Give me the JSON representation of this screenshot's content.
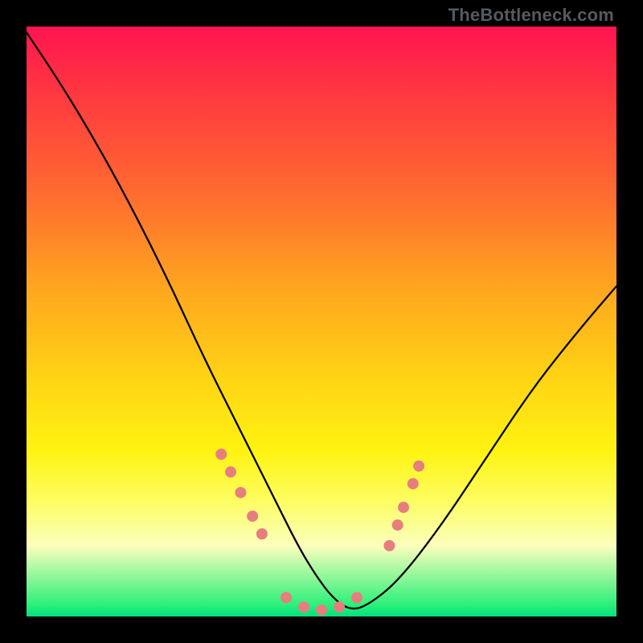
{
  "attribution": "TheBottleneck.com",
  "chart_data": {
    "type": "line",
    "title": "",
    "subtitle": "",
    "xlabel": "",
    "ylabel": "",
    "xlim": [
      0,
      100
    ],
    "ylim": [
      0,
      100
    ],
    "grid": false,
    "background_gradient": {
      "stops": [
        {
          "pos": 0.0,
          "color": "#ff1450"
        },
        {
          "pos": 0.12,
          "color": "#ff3a3f"
        },
        {
          "pos": 0.28,
          "color": "#ff6a30"
        },
        {
          "pos": 0.45,
          "color": "#ffa81e"
        },
        {
          "pos": 0.6,
          "color": "#ffd514"
        },
        {
          "pos": 0.72,
          "color": "#fff312"
        },
        {
          "pos": 0.8,
          "color": "#fdfd5e"
        },
        {
          "pos": 0.88,
          "color": "#fcfebc"
        },
        {
          "pos": 0.98,
          "color": "#2df07a"
        },
        {
          "pos": 1.0,
          "color": "#00e27e"
        }
      ]
    },
    "series": [
      {
        "name": "bottleneck-curve",
        "color": "#000000",
        "x": [
          0,
          6,
          12,
          18,
          24,
          30,
          36,
          42,
          46,
          49,
          52,
          55,
          58,
          63,
          70,
          78,
          86,
          94,
          100
        ],
        "y": [
          99,
          90,
          80,
          69,
          57,
          44,
          32,
          20,
          12,
          7,
          3,
          1,
          2,
          6,
          15,
          27,
          39,
          49,
          56
        ]
      }
    ],
    "markers": {
      "color": "#e77e7e",
      "radius_px": 7,
      "points": [
        {
          "x": 33.0,
          "y": 27.5
        },
        {
          "x": 34.6,
          "y": 24.5
        },
        {
          "x": 36.3,
          "y": 21.0
        },
        {
          "x": 38.3,
          "y": 17.0
        },
        {
          "x": 39.9,
          "y": 14.0
        },
        {
          "x": 44.0,
          "y": 3.2
        },
        {
          "x": 47.0,
          "y": 1.6
        },
        {
          "x": 50.0,
          "y": 1.1
        },
        {
          "x": 53.0,
          "y": 1.6
        },
        {
          "x": 56.0,
          "y": 3.2
        },
        {
          "x": 61.5,
          "y": 12.0
        },
        {
          "x": 62.9,
          "y": 15.5
        },
        {
          "x": 63.9,
          "y": 18.5
        },
        {
          "x": 65.5,
          "y": 22.5
        },
        {
          "x": 66.5,
          "y": 25.5
        }
      ]
    }
  }
}
